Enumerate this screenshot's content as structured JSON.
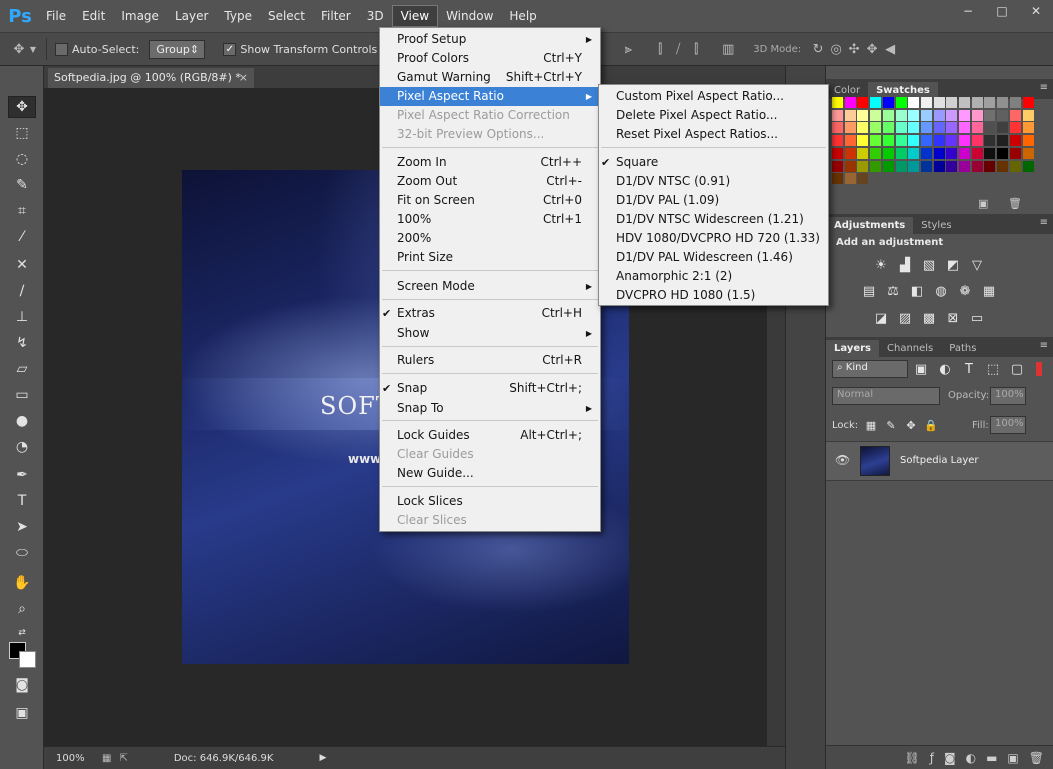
{
  "app": {
    "logo": "Ps",
    "menus": [
      "File",
      "Edit",
      "Image",
      "Layer",
      "Type",
      "Select",
      "Filter",
      "3D",
      "View",
      "Window",
      "Help"
    ],
    "active_menu": "View",
    "window_controls": [
      "−",
      "□",
      "✕"
    ]
  },
  "options_bar": {
    "auto_select_label": "Auto-Select:",
    "auto_select_value": "Group",
    "show_transform_label": "Show Transform Controls",
    "mode_3d_label": "3D Mode:"
  },
  "document": {
    "tab_title": "Softpedia.jpg @ 100% (RGB/8#) *",
    "tab_close": "×",
    "image_title": "SOFT",
    "image_url": "www."
  },
  "status_bar": {
    "zoom": "100%",
    "doc_info": "Doc: 646.9K/646.9K"
  },
  "view_menu": {
    "items": [
      {
        "label": "Proof Setup",
        "shortcut": "",
        "submenu": true,
        "disabled": false
      },
      {
        "label": "Proof Colors",
        "shortcut": "Ctrl+Y",
        "submenu": false,
        "disabled": false
      },
      {
        "label": "Gamut Warning",
        "shortcut": "Shift+Ctrl+Y",
        "submenu": false,
        "disabled": false
      },
      {
        "label": "Pixel Aspect Ratio",
        "shortcut": "",
        "submenu": true,
        "disabled": false,
        "highlighted": true
      },
      {
        "label": "Pixel Aspect Ratio Correction",
        "shortcut": "",
        "submenu": false,
        "disabled": true
      },
      {
        "label": "32-bit Preview Options...",
        "shortcut": "",
        "submenu": false,
        "disabled": true
      },
      {
        "label": "Zoom In",
        "shortcut": "Ctrl++",
        "submenu": false,
        "disabled": false
      },
      {
        "label": "Zoom Out",
        "shortcut": "Ctrl+-",
        "submenu": false,
        "disabled": false
      },
      {
        "label": "Fit on Screen",
        "shortcut": "Ctrl+0",
        "submenu": false,
        "disabled": false
      },
      {
        "label": "100%",
        "shortcut": "Ctrl+1",
        "submenu": false,
        "disabled": false
      },
      {
        "label": "200%",
        "shortcut": "",
        "submenu": false,
        "disabled": false
      },
      {
        "label": "Print Size",
        "shortcut": "",
        "submenu": false,
        "disabled": false
      },
      {
        "label": "Screen Mode",
        "shortcut": "",
        "submenu": true,
        "disabled": false
      },
      {
        "label": "Extras",
        "shortcut": "Ctrl+H",
        "submenu": false,
        "disabled": false,
        "checked": true
      },
      {
        "label": "Show",
        "shortcut": "",
        "submenu": true,
        "disabled": false
      },
      {
        "label": "Rulers",
        "shortcut": "Ctrl+R",
        "submenu": false,
        "disabled": false
      },
      {
        "label": "Snap",
        "shortcut": "Shift+Ctrl+;",
        "submenu": false,
        "disabled": false,
        "checked": true
      },
      {
        "label": "Snap To",
        "shortcut": "",
        "submenu": true,
        "disabled": false
      },
      {
        "label": "Lock Guides",
        "shortcut": "Alt+Ctrl+;",
        "submenu": false,
        "disabled": false
      },
      {
        "label": "Clear Guides",
        "shortcut": "",
        "submenu": false,
        "disabled": true
      },
      {
        "label": "New Guide...",
        "shortcut": "",
        "submenu": false,
        "disabled": false
      },
      {
        "label": "Lock Slices",
        "shortcut": "",
        "submenu": false,
        "disabled": false
      },
      {
        "label": "Clear Slices",
        "shortcut": "",
        "submenu": false,
        "disabled": true
      }
    ]
  },
  "aspect_submenu": {
    "items": [
      {
        "label": "Custom Pixel Aspect Ratio...",
        "checked": false
      },
      {
        "label": "Delete Pixel Aspect Ratio...",
        "checked": false
      },
      {
        "label": "Reset Pixel Aspect Ratios...",
        "checked": false
      },
      {
        "label": "Square",
        "checked": true
      },
      {
        "label": "D1/DV NTSC (0.91)",
        "checked": false
      },
      {
        "label": "D1/DV PAL (1.09)",
        "checked": false
      },
      {
        "label": "D1/DV NTSC Widescreen (1.21)",
        "checked": false
      },
      {
        "label": "HDV 1080/DVCPRO HD 720 (1.33)",
        "checked": false
      },
      {
        "label": "D1/DV PAL Widescreen (1.46)",
        "checked": false
      },
      {
        "label": "Anamorphic 2:1 (2)",
        "checked": false
      },
      {
        "label": "DVCPRO HD 1080 (1.5)",
        "checked": false
      }
    ]
  },
  "panels": {
    "color_tabs": [
      "Color",
      "Swatches"
    ],
    "adjust_tabs": [
      "Adjustments",
      "Styles"
    ],
    "add_adjustment": "Add an adjustment",
    "layer_tabs": [
      "Layers",
      "Channels",
      "Paths"
    ],
    "kind_label": "Kind",
    "blend_mode": "Normal",
    "opacity_label": "Opacity:",
    "opacity_value": "100%",
    "lock_label": "Lock:",
    "fill_label": "Fill:",
    "fill_value": "100%",
    "layer_name": "Softpedia Layer"
  },
  "swatches": [
    [
      "#ffff00",
      "#ff00ff",
      "#ff0000",
      "#00ffff",
      "#0000ff",
      "#00ff00",
      "#ffffff",
      "#f0f0f0",
      "#e0e0e0",
      "#d0d0d0",
      "#c0c0c0",
      "#b0b0b0",
      "#a0a0a0",
      "#909090",
      "#808080",
      "#ff0000"
    ],
    [
      "#ff9999",
      "#ffcc99",
      "#ffff99",
      "#ccff99",
      "#99ff99",
      "#99ffcc",
      "#99ffff",
      "#99ccff",
      "#9999ff",
      "#cc99ff",
      "#ff99ff",
      "#ff99cc",
      "#707070",
      "#606060",
      "#ff6666",
      "#ffcc66"
    ],
    [
      "#ff6666",
      "#ff9966",
      "#ffff66",
      "#99ff66",
      "#66ff66",
      "#66ffcc",
      "#66ffff",
      "#6699ff",
      "#6666ff",
      "#9966ff",
      "#ff66ff",
      "#ff6699",
      "#505050",
      "#404040",
      "#ff3333",
      "#ff9933"
    ],
    [
      "#ff3333",
      "#ff6633",
      "#ffff33",
      "#66ff33",
      "#33ff33",
      "#33ff99",
      "#33ffff",
      "#3366ff",
      "#3333ff",
      "#6633ff",
      "#ff33ff",
      "#ff3366",
      "#303030",
      "#202020",
      "#cc0000",
      "#ff6600"
    ],
    [
      "#cc0000",
      "#cc3300",
      "#cccc00",
      "#33cc00",
      "#00cc00",
      "#00cc66",
      "#00cccc",
      "#0033cc",
      "#0000cc",
      "#3300cc",
      "#cc00cc",
      "#cc0033",
      "#101010",
      "#000000",
      "#990000",
      "#cc6600"
    ],
    [
      "#990000",
      "#993300",
      "#999900",
      "#339900",
      "#009900",
      "#009966",
      "#009999",
      "#003399",
      "#000099",
      "#330099",
      "#990099",
      "#990033",
      "#660000",
      "#663300",
      "#666600",
      "#006600"
    ],
    [
      "#663300",
      "#996633",
      "#664422"
    ]
  ]
}
